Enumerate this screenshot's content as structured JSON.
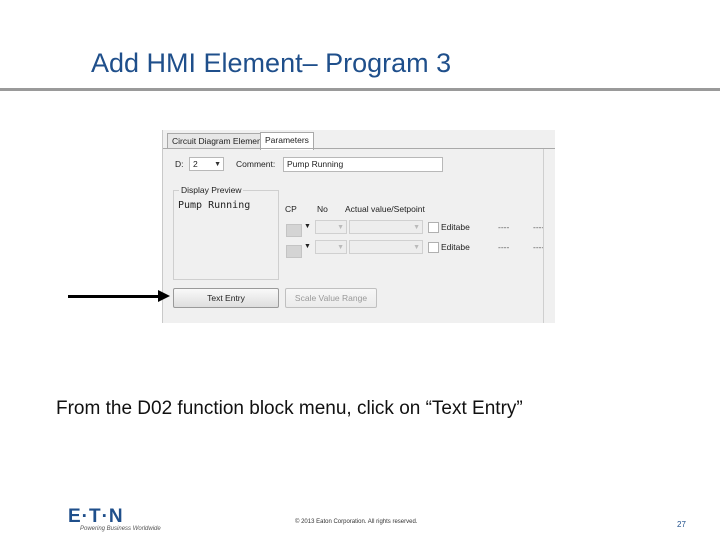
{
  "slide": {
    "title": "Add HMI Element– Program 3",
    "caption": "From the D02 function block menu, click on “Text Entry”",
    "footer": {
      "logo": "E·T·N",
      "tagline": "Powering Business Worldwide",
      "copyright": "© 2013 Eaton Corporation. All rights reserved.",
      "page_number": "27"
    },
    "brand_color": "#1f4f8b"
  },
  "dialog": {
    "tabs": [
      {
        "label": "Circuit Diagram Element",
        "active": false
      },
      {
        "label": "Parameters",
        "active": true
      }
    ],
    "d_label": "D:",
    "d_value": "2",
    "comment_label": "Comment:",
    "comment_value": "Pump Running",
    "display_preview": {
      "title": "Display Preview",
      "text": "Pump Running"
    },
    "columns": {
      "cp": "CP",
      "no": "No",
      "actual": "Actual value/Setpoint"
    },
    "rows": [
      {
        "editable_label": "Editabe",
        "dash1": "----",
        "dash2": "----"
      },
      {
        "editable_label": "Editabe",
        "dash1": "----",
        "dash2": "----"
      }
    ],
    "buttons": {
      "text_entry": "Text Entry",
      "scale_value_range": "Scale Value Range"
    }
  }
}
